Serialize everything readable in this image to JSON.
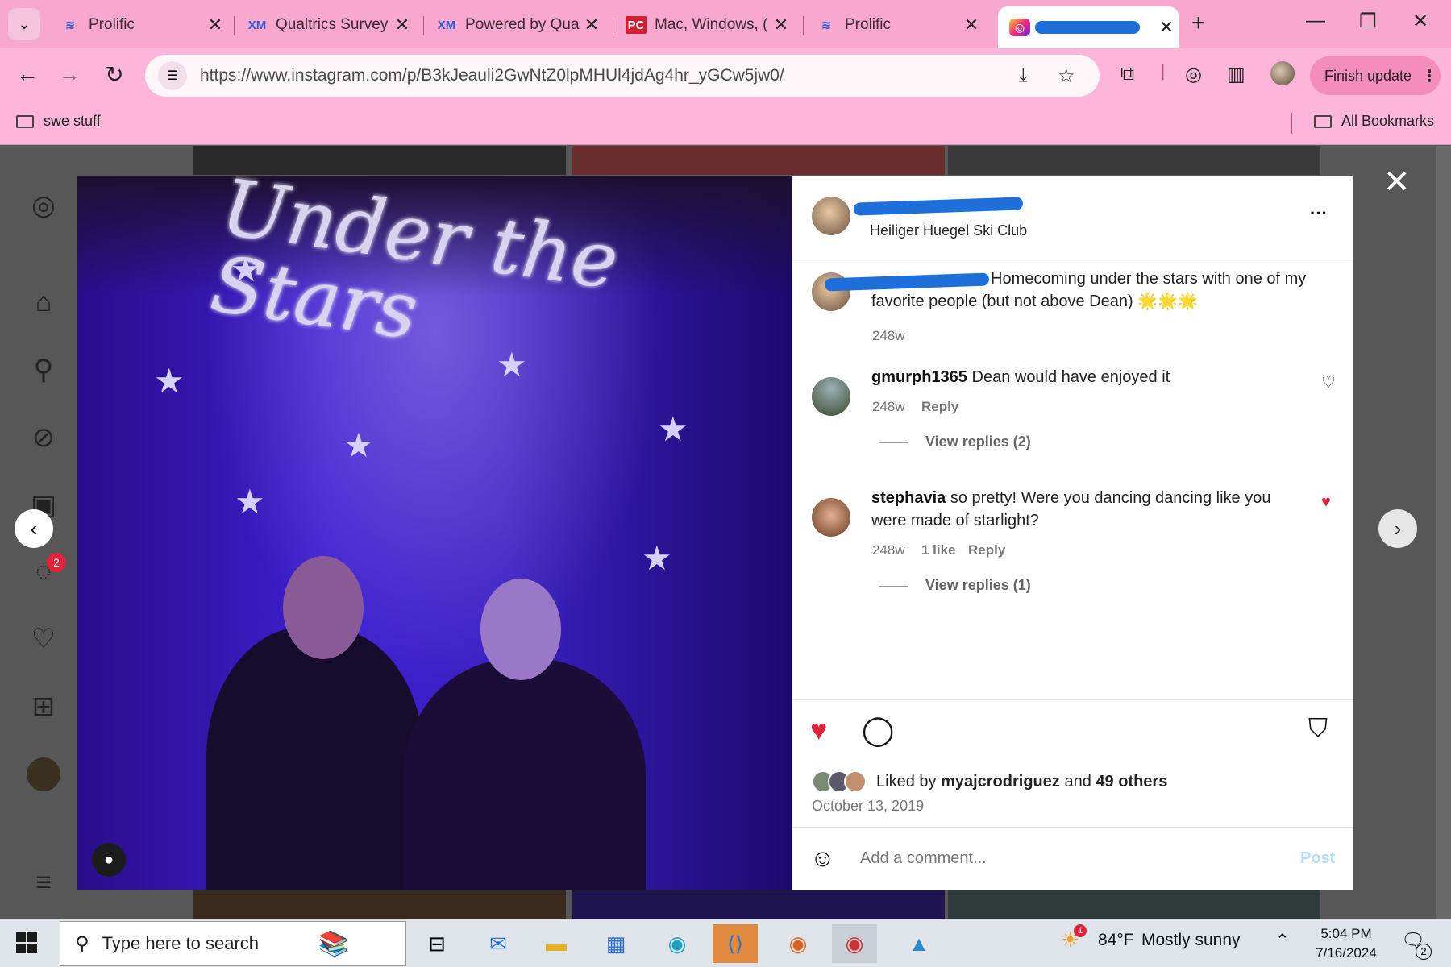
{
  "browser": {
    "tabs": [
      {
        "title": "Prolific",
        "favicon": "prolific-icon",
        "active": false
      },
      {
        "title": "Qualtrics Survey",
        "favicon": "xm-icon",
        "active": false
      },
      {
        "title": "Powered by Qua",
        "favicon": "xm-icon",
        "active": false
      },
      {
        "title": "Mac, Windows, (",
        "favicon": "pc-icon",
        "active": false
      },
      {
        "title": "Prolific",
        "favicon": "prolific-icon",
        "active": false
      },
      {
        "title": "",
        "favicon": "instagram-icon",
        "active": true
      }
    ],
    "url": "https://www.instagram.com/p/B3kJeauli2GwNtZ0lpMHUl4jdAg4hr_yGCw5jw0/",
    "finish_update": "Finish update",
    "bookmarks": {
      "left": "swe stuff",
      "right": "All Bookmarks"
    }
  },
  "post": {
    "location": "Heiliger Huegel Ski Club",
    "caption": "Homecoming under the stars with one of my favorite people (but not above Dean) 🌟🌟🌟",
    "caption_time": "248w",
    "comments": [
      {
        "user": "gmurph1365",
        "text": "Dean would have enjoyed it",
        "time": "248w",
        "likes": "",
        "reply": "Reply",
        "view_replies": "View replies (2)",
        "liked": false
      },
      {
        "user": "stephavia",
        "text": "so pretty! Were you dancing dancing like you were made of starlight?",
        "time": "248w",
        "likes": "1 like",
        "reply": "Reply",
        "view_replies": "View replies (1)",
        "liked": true
      }
    ],
    "liked_by_prefix": "Liked by",
    "liked_by_user": "myajcrodriguez",
    "liked_by_and": "and",
    "liked_by_others": "49 others",
    "date": "October 13, 2019",
    "add_comment_placeholder": "Add a comment...",
    "post_label": "Post"
  },
  "photo": {
    "sign_text": "Under the Stars"
  },
  "sidebar": {
    "messages_badge": "2"
  },
  "taskbar": {
    "search_placeholder": "Type here to search",
    "weather_temp": "84°F",
    "weather_desc": "Mostly sunny",
    "weather_badge": "1",
    "time": "5:04 PM",
    "date": "7/16/2024",
    "notifications": "2"
  },
  "colors": {
    "tabstrip": "#f8a8cf",
    "toolbar": "#fdb6da",
    "like_red": "#e0223a",
    "post_blue": "#b3dbff"
  }
}
